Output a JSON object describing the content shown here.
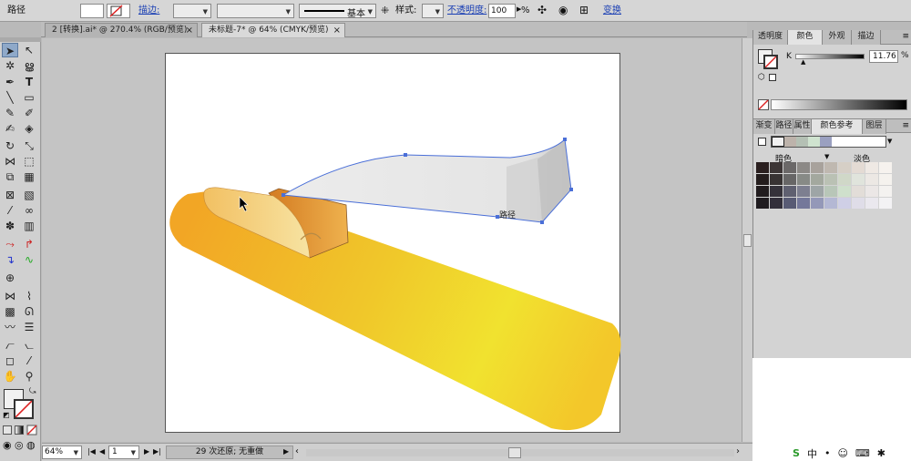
{
  "control_bar": {
    "object_type": "路径",
    "stroke_label": "描边:",
    "stroke_style": "基本",
    "style_label": "样式:",
    "opacity_label": "不透明度:",
    "opacity_value": "100",
    "opacity_unit": "%",
    "transform_label": "变换"
  },
  "document_tabs": [
    {
      "label": "2 [转换].ai* @ 270.4% (RGB/预览)",
      "active": false
    },
    {
      "label": "未标题-7* @ 64% (CMYK/预览)",
      "active": true
    }
  ],
  "canvas": {
    "path_tooltip": "路径"
  },
  "status_bar": {
    "zoom": "64%",
    "artboard_number": "1",
    "status_text": "29 次还原; 无重做"
  },
  "color_panel": {
    "tabs": [
      "透明度",
      "颜色",
      "外观",
      "描边"
    ],
    "active_tab": "颜色",
    "channel_label": "K",
    "k_value": "11.76",
    "k_unit": "%"
  },
  "guide_panel": {
    "tabs": [
      "渐变",
      "路径",
      "属性",
      "颜色参考",
      "图层"
    ],
    "active_tab": "颜色参考",
    "shades_label": "暗色",
    "tints_label": "淡色",
    "swatches": [
      [
        "#2a1f1f",
        "#3d3636",
        "#6b6868",
        "#8c8986",
        "#a8a29c",
        "#bfb8b0",
        "#d6cfc6",
        "#e4dbd4",
        "#efe9e4",
        "#f6f2ee"
      ],
      [
        "#241d1d",
        "#383333",
        "#676666",
        "#878a86",
        "#a3a89e",
        "#bac1b4",
        "#d0d8c8",
        "#e0e4dc",
        "#ece8e4",
        "#f5f2ee"
      ],
      [
        "#211c1e",
        "#35323a",
        "#5f6070",
        "#7d7f90",
        "#9ea5a6",
        "#b8c6b8",
        "#cfe0cc",
        "#e2ddd8",
        "#ebe7e6",
        "#f4f2f0"
      ],
      [
        "#1f1b1f",
        "#322f3a",
        "#585b74",
        "#74789a",
        "#9498b8",
        "#b4b8d4",
        "#cfcfe6",
        "#dfdde8",
        "#eae8ee",
        "#f3f2f4"
      ]
    ]
  },
  "colors": {
    "accent_blue": "#4a6fd8",
    "panel_bg": "#d3d3d3",
    "yellow_start": "#f4b02a",
    "yellow_end": "#f0e030"
  }
}
